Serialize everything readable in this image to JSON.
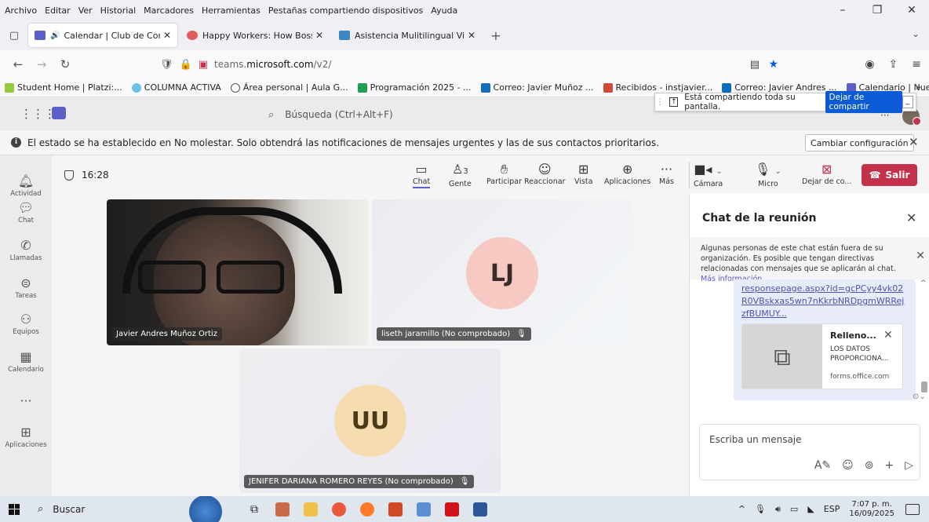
{
  "browser": {
    "menu": [
      "Archivo",
      "Editar",
      "Ver",
      "Historial",
      "Marcadores",
      "Herramientas",
      "Pestañas compartiendo dispositivos",
      "Ayuda"
    ],
    "tabs": [
      {
        "label": "Calendar | Club de Convers",
        "icon_color": "#5b5fc7",
        "active": true
      },
      {
        "label": "Happy Workers: How Bosses Ca",
        "icon_color": "#e45b5b",
        "active": false
      },
      {
        "label": "Asistencia Mulitilingual Virtual (",
        "icon_color": "#3b88c4",
        "active": false
      }
    ],
    "url_prefix": "teams.",
    "url_host": "microsoft.com",
    "url_path": "/v2/",
    "bookmarks": [
      {
        "label": "Student Home | Platzi:...",
        "color": "#98c93c"
      },
      {
        "label": "COLUMNA ACTIVA",
        "color": "#6bc1e8"
      },
      {
        "label": "Área personal | Aula G...",
        "color": "#555555"
      },
      {
        "label": "Programación 2025 - ...",
        "color": "#1f9e54"
      },
      {
        "label": "Correo: Javier Muñoz ...",
        "color": "#0f6cbd"
      },
      {
        "label": "Recibidos - instjavier...",
        "color": "#d14836"
      },
      {
        "label": "Correo: Javier Andres ...",
        "color": "#0f6cbd"
      },
      {
        "label": "Calendario | Nueva re...",
        "color": "#5b5fc7"
      }
    ]
  },
  "share_popup": {
    "text": "Está compartiendo toda su pantalla.",
    "stop_label": "Dejar de compartir"
  },
  "teams": {
    "search_placeholder": "Búsqueda (Ctrl+Alt+F)",
    "notification": "El estado se ha establecido en No molestar. Solo obtendrá las notificaciones de mensajes urgentes y las de sus contactos prioritarios.",
    "change_config": "Cambiar configuración",
    "rail": [
      {
        "label": "Actividad",
        "icon": "bell-icon"
      },
      {
        "label": "Chat",
        "icon": "chat-icon"
      },
      {
        "label": "Llamadas",
        "icon": "phone-icon"
      },
      {
        "label": "Tareas",
        "icon": "tasks-icon"
      },
      {
        "label": "Equipos",
        "icon": "teams-icon"
      },
      {
        "label": "Calendario",
        "icon": "calendar-icon"
      },
      {
        "label": "Aplicaciones",
        "icon": "apps-icon"
      }
    ],
    "meeting_time": "16:28",
    "toolbar": {
      "chat": "Chat",
      "people": "Gente",
      "people_count": "3",
      "raise": "Participar",
      "react": "Reaccionar",
      "view": "Vista",
      "apps": "Aplicaciones",
      "more": "Más",
      "camera": "Cámara",
      "mic": "Micro",
      "share": "Dejar de co...",
      "leave": "Salir"
    },
    "participants": [
      {
        "name": "Javier Andres Muñoz Ortiz",
        "initials": ""
      },
      {
        "name": "liseth jaramillo (No comprobado)",
        "initials": "LJ"
      },
      {
        "name": "JENIFER DARIANA ROMERO REYES (No comprobado)",
        "initials": "UU"
      }
    ],
    "chat": {
      "title": "Chat de la reunión",
      "warning": "Algunas personas de este chat están fuera de su organización. Es posible que tengan directivas relacionadas con mensajes que se aplicarán al chat.",
      "more_info": "Más información",
      "link_text": "responsepage.aspx?id=gcPCyy4vk02R0VBskxas5wn7nKkrbNRDpgmWRRejzfBUMUY...",
      "card_title": "Relleno...",
      "card_desc": "LOS DATOS PROPORCIONA...",
      "card_domain": "forms.office.com",
      "compose_placeholder": "Escriba un mensaje"
    }
  },
  "taskbar": {
    "search": "Buscar",
    "lang": "ESP",
    "time": "7:07 p. m.",
    "date": "16/09/2025"
  }
}
